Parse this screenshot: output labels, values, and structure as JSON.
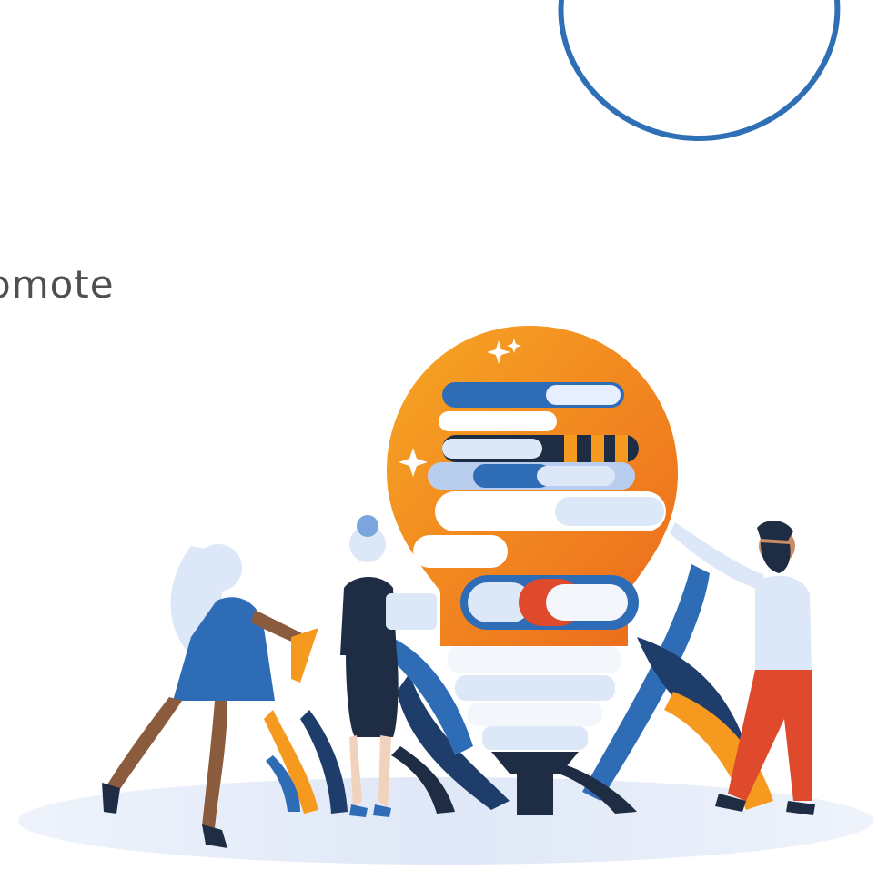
{
  "slide": {
    "partial_text": "omote"
  },
  "colors": {
    "circle_stroke": "#2f6fb5",
    "bulb_orange": "#f59a1e",
    "bulb_orange_dark": "#ec6a1c",
    "navy": "#1f3d6b",
    "blue": "#2f6cb6",
    "pale_blue": "#dce7f7",
    "red": "#de4a2b",
    "text_gray": "#4f4f4f"
  },
  "illustration": {
    "subject": "lightbulb-with-books",
    "figures": [
      "running-woman",
      "woman-with-laptop",
      "bearded-man-pointing"
    ],
    "icons": [
      "sparkle-icon",
      "leaf-icon"
    ]
  }
}
